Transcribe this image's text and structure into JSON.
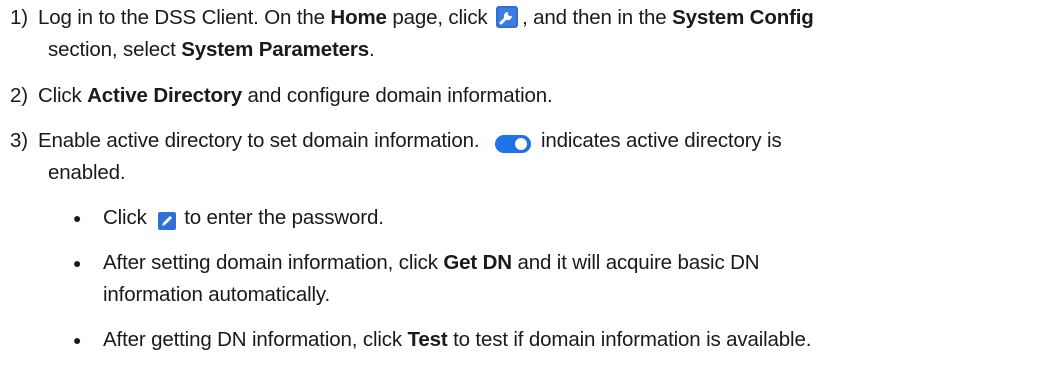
{
  "steps": [
    {
      "number": "1)",
      "line1": {
        "t1": "Log in to the DSS Client. On the ",
        "b1": "Home",
        "t2": " page, click ",
        "icon": "wrench-icon",
        "t3": ", and then in the ",
        "b2": "System Config"
      },
      "line2": {
        "t1": "section, select ",
        "b1": "System Parameters",
        "t2": "."
      }
    },
    {
      "number": "2)",
      "t1": "Click ",
      "b1": "Active Directory",
      "t2": " and configure domain information."
    },
    {
      "number": "3)",
      "line1": {
        "t1": "Enable active directory to set domain information. ",
        "icon": "toggle-on-icon",
        "t2": "indicates active directory is"
      },
      "line2": {
        "t1": "enabled."
      }
    }
  ],
  "bullets": [
    {
      "symbol": "●",
      "t1": "Click ",
      "icon": "pencil-icon",
      "t2": "to enter the password."
    },
    {
      "symbol": "●",
      "line1": {
        "t1": "After setting domain information, click ",
        "b1": "Get DN",
        "t2": " and it will acquire basic DN"
      },
      "line2": {
        "t1": "information automatically."
      }
    },
    {
      "symbol": "●",
      "t1": "After getting DN information, click ",
      "b1": "Test",
      "t2": " to test if domain information is available."
    }
  ],
  "colors": {
    "text": "#1a1a1a",
    "toggle_track": "#1e73e8",
    "toggle_knob": "#ffffff",
    "wrench_bg": "#2f6fd6",
    "pencil_bg": "#2f6fd6"
  }
}
